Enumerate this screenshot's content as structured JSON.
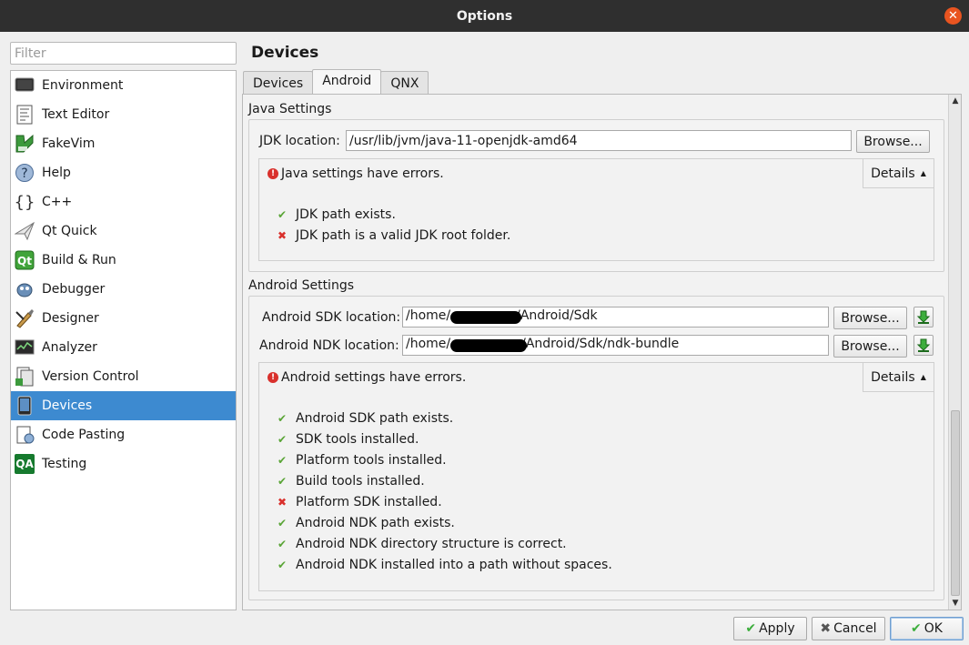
{
  "window": {
    "title": "Options"
  },
  "filter": {
    "placeholder": "Filter"
  },
  "sidebar": {
    "items": [
      {
        "label": "Environment",
        "icon": "monitor-icon"
      },
      {
        "label": "Text Editor",
        "icon": "text-editor-icon"
      },
      {
        "label": "FakeVim",
        "icon": "fakevim-icon"
      },
      {
        "label": "Help",
        "icon": "help-icon"
      },
      {
        "label": "C++",
        "icon": "cpp-braces-icon"
      },
      {
        "label": "Qt Quick",
        "icon": "qt-quick-icon"
      },
      {
        "label": "Build & Run",
        "icon": "build-run-icon"
      },
      {
        "label": "Debugger",
        "icon": "debugger-icon"
      },
      {
        "label": "Designer",
        "icon": "designer-icon"
      },
      {
        "label": "Analyzer",
        "icon": "analyzer-icon"
      },
      {
        "label": "Version Control",
        "icon": "version-control-icon"
      },
      {
        "label": "Devices",
        "icon": "devices-icon",
        "selected": true
      },
      {
        "label": "Code Pasting",
        "icon": "code-pasting-icon"
      },
      {
        "label": "Testing",
        "icon": "qa-testing-icon",
        "badge": "QA"
      }
    ]
  },
  "page": {
    "title": "Devices"
  },
  "tabs": [
    {
      "label": "Devices"
    },
    {
      "label": "Android",
      "active": true
    },
    {
      "label": "QNX"
    }
  ],
  "java": {
    "group_title": "Java Settings",
    "jdk_label": "JDK location:",
    "jdk_value": "/usr/lib/jvm/java-11-openjdk-amd64",
    "browse_label": "Browse...",
    "summary": "Java settings have errors.",
    "details_label": "Details",
    "checks": [
      {
        "text": "JDK path exists.",
        "ok": true
      },
      {
        "text": "JDK path is a valid JDK root folder.",
        "ok": false
      }
    ]
  },
  "android": {
    "group_title": "Android Settings",
    "sdk_label": "Android SDK location:",
    "sdk_value_prefix": "/home/",
    "sdk_value_suffix": "/Android/Sdk",
    "ndk_label": "Android NDK location:",
    "ndk_value_prefix": "/home/",
    "ndk_value_suffix": "/Android/Sdk/ndk-bundle",
    "browse_label": "Browse...",
    "summary": "Android settings have errors.",
    "details_label": "Details",
    "checks": [
      {
        "text": "Android SDK path exists.",
        "ok": true
      },
      {
        "text": "SDK tools installed.",
        "ok": true
      },
      {
        "text": "Platform tools installed.",
        "ok": true
      },
      {
        "text": "Build tools installed.",
        "ok": true
      },
      {
        "text": "Platform SDK installed.",
        "ok": false
      },
      {
        "text": "Android NDK path exists.",
        "ok": true
      },
      {
        "text": "Android NDK directory structure is correct.",
        "ok": true
      },
      {
        "text": "Android NDK installed into a path without spaces.",
        "ok": true
      }
    ]
  },
  "buttons": {
    "apply": "Apply",
    "cancel": "Cancel",
    "ok": "OK"
  },
  "colors": {
    "selection": "#3d8ad0",
    "ok_mark": "#5aa537",
    "error_mark": "#d9302c",
    "titlebar": "#2f2f2f",
    "close": "#e95420"
  }
}
